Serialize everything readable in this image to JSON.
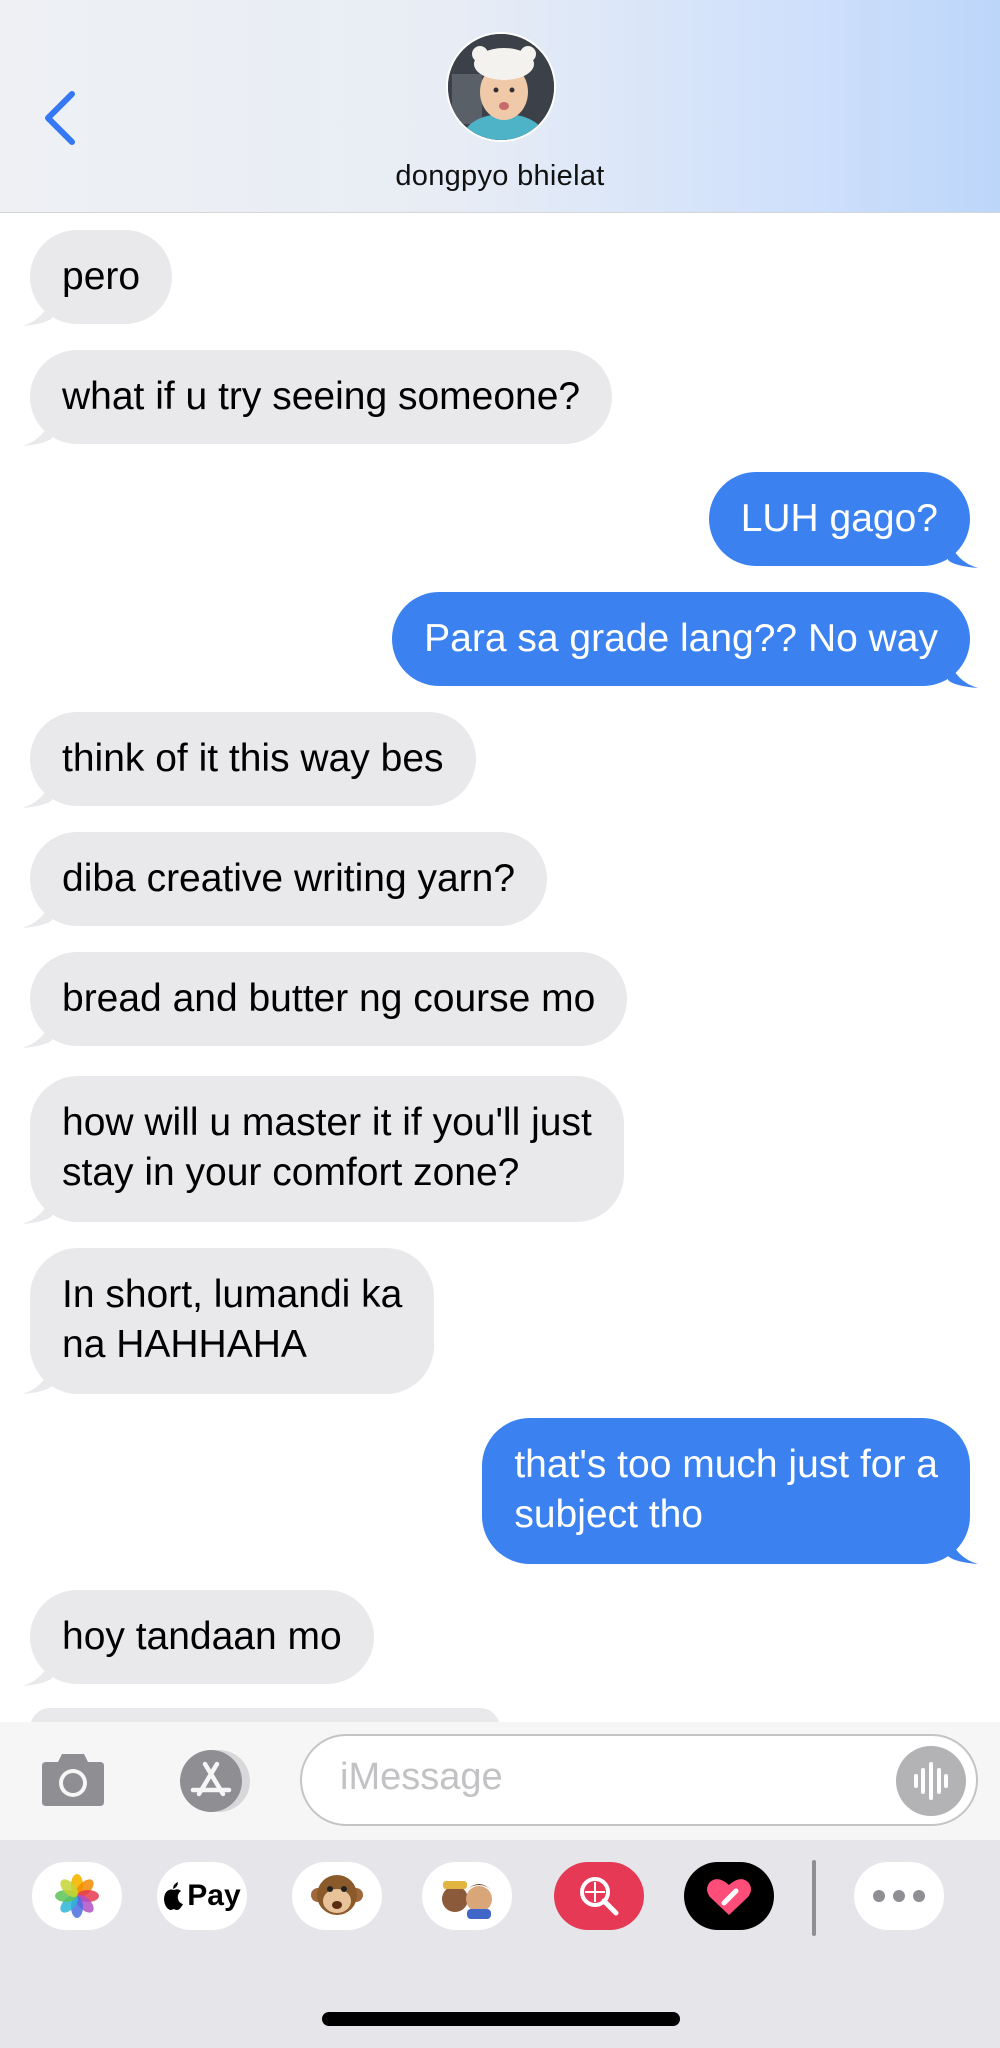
{
  "header": {
    "contact_name": "dongpyo bhielat"
  },
  "messages": [
    {
      "direction": "in",
      "lines": [
        "pero"
      ]
    },
    {
      "direction": "in",
      "lines": [
        "what if u try seeing someone?"
      ]
    },
    {
      "direction": "out",
      "lines": [
        "LUH gago?"
      ]
    },
    {
      "direction": "out",
      "lines": [
        "Para sa grade lang?? No way"
      ]
    },
    {
      "direction": "in",
      "lines": [
        "think of it this way bes"
      ]
    },
    {
      "direction": "in",
      "lines": [
        "diba creative writing yarn?"
      ]
    },
    {
      "direction": "in",
      "lines": [
        "bread and butter ng course mo"
      ]
    },
    {
      "direction": "in",
      "lines": [
        "how will u master it if you'll just",
        "stay in your comfort zone?"
      ]
    },
    {
      "direction": "in",
      "lines": [
        "In short, lumandi ka",
        "na HAHHAHA"
      ]
    },
    {
      "direction": "out",
      "lines": [
        "that's too much just for a",
        "subject tho"
      ]
    },
    {
      "direction": "in",
      "lines": [
        "hoy tandaan mo"
      ]
    }
  ],
  "compose": {
    "placeholder": "iMessage"
  },
  "app_drawer": {
    "apple_pay_label": "Pay",
    "items": [
      "photos-icon",
      "apple-pay-icon",
      "monkey-memoji-icon",
      "memoji-stickers-icon",
      "image-search-icon",
      "digital-touch-icon",
      "more-icon"
    ]
  },
  "colors": {
    "incoming_bubble": "#e9e9eb",
    "outgoing_bubble": "#3b82f0",
    "accent": "#3478f6"
  }
}
